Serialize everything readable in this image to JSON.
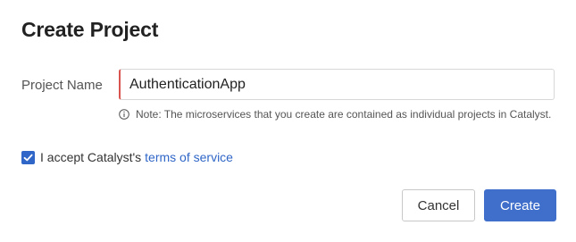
{
  "dialog": {
    "title": "Create Project",
    "project_name_label": "Project Name",
    "project_name_value": "AuthenticationApp",
    "note": "Note: The microservices that you create are contained as individual projects in Catalyst.",
    "accept_prefix": "I accept Catalyst's",
    "terms_link": "terms of service",
    "accept_checked": true,
    "cancel_label": "Cancel",
    "create_label": "Create"
  },
  "colors": {
    "accent": "#2f66c7",
    "primary_button": "#3f6fcb",
    "input_error_edge": "#d9534f"
  },
  "icons": {
    "info": "info-circle-icon",
    "check": "check-icon"
  }
}
